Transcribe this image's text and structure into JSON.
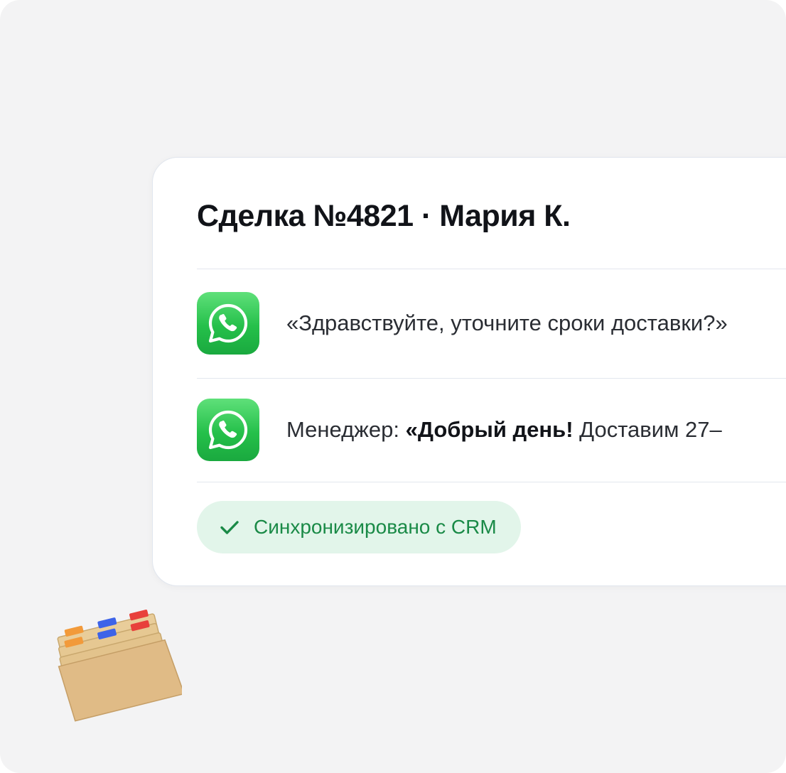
{
  "deal": {
    "title": "Сделка №4821 · Мария К."
  },
  "messages": [
    {
      "icon": "whatsapp-icon",
      "text": "«Здравствуйте, уточните сроки доставки?»"
    },
    {
      "icon": "whatsapp-icon",
      "prefix": "Менеджер: ",
      "bold": "«Добрый день!",
      "rest": " Доставим 27–"
    }
  ],
  "status": {
    "icon": "check-icon",
    "label": "Синхронизировано с CRM"
  },
  "decoration": {
    "icon": "file-box-icon"
  },
  "colors": {
    "whatsapp_green": "#25c04a",
    "badge_bg": "#e2f5ea",
    "badge_text": "#1a8a47",
    "canvas_bg": "#f3f3f4"
  }
}
